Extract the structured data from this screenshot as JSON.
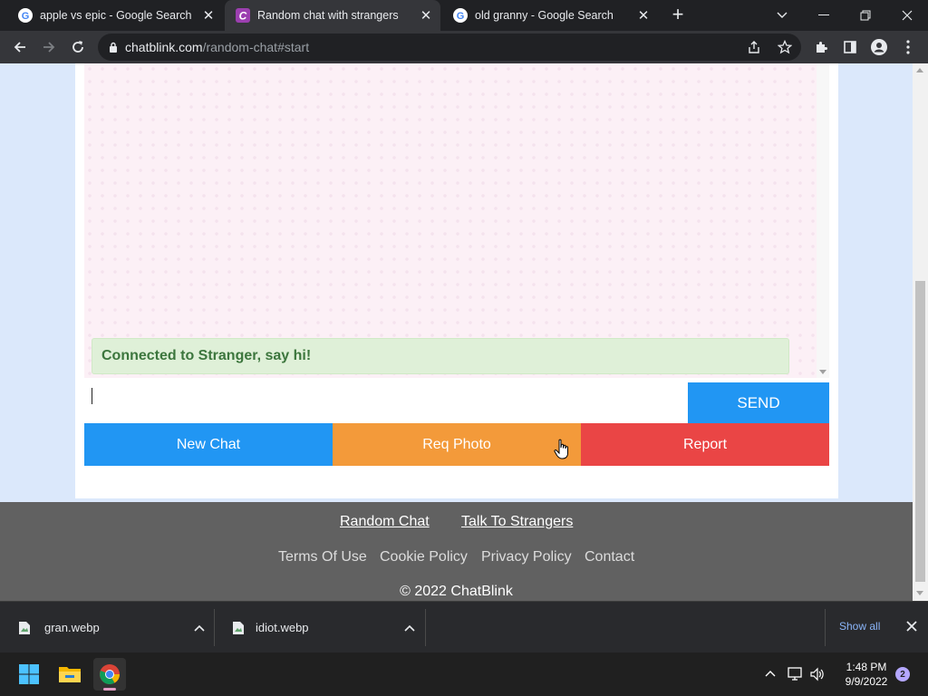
{
  "browser": {
    "tabs": [
      {
        "title": "apple vs epic - Google Search",
        "favicon": "google-g-icon",
        "active": false
      },
      {
        "title": "Random chat with strangers",
        "favicon": "chatblink-c-icon",
        "active": true
      },
      {
        "title": "old granny - Google Search",
        "favicon": "google-g-icon",
        "active": false
      }
    ],
    "url_host": "chatblink.com",
    "url_path": "/random-chat#start"
  },
  "chat": {
    "status_message": "Connected to Stranger, say hi!",
    "input_value": "",
    "send_label": "SEND",
    "actions": {
      "new_chat": "New Chat",
      "req_photo": "Req Photo",
      "report": "Report"
    },
    "colors": {
      "send": "#2196f3",
      "new_chat": "#2196f3",
      "req_photo": "#f39a3a",
      "report": "#ea4545",
      "status_bg": "#dff0d8",
      "status_text": "#3c763d"
    }
  },
  "footer": {
    "primary_links": [
      "Random Chat",
      "Talk To Strangers"
    ],
    "secondary_links": [
      "Terms Of Use",
      "Cookie Policy",
      "Privacy Policy",
      "Contact"
    ],
    "copyright": "© 2022 ChatBlink"
  },
  "downloads": {
    "items": [
      {
        "filename": "gran.webp"
      },
      {
        "filename": "idiot.webp"
      }
    ],
    "show_all": "Show all"
  },
  "taskbar": {
    "time": "1:48 PM",
    "date": "9/9/2022",
    "notifications": "2"
  }
}
